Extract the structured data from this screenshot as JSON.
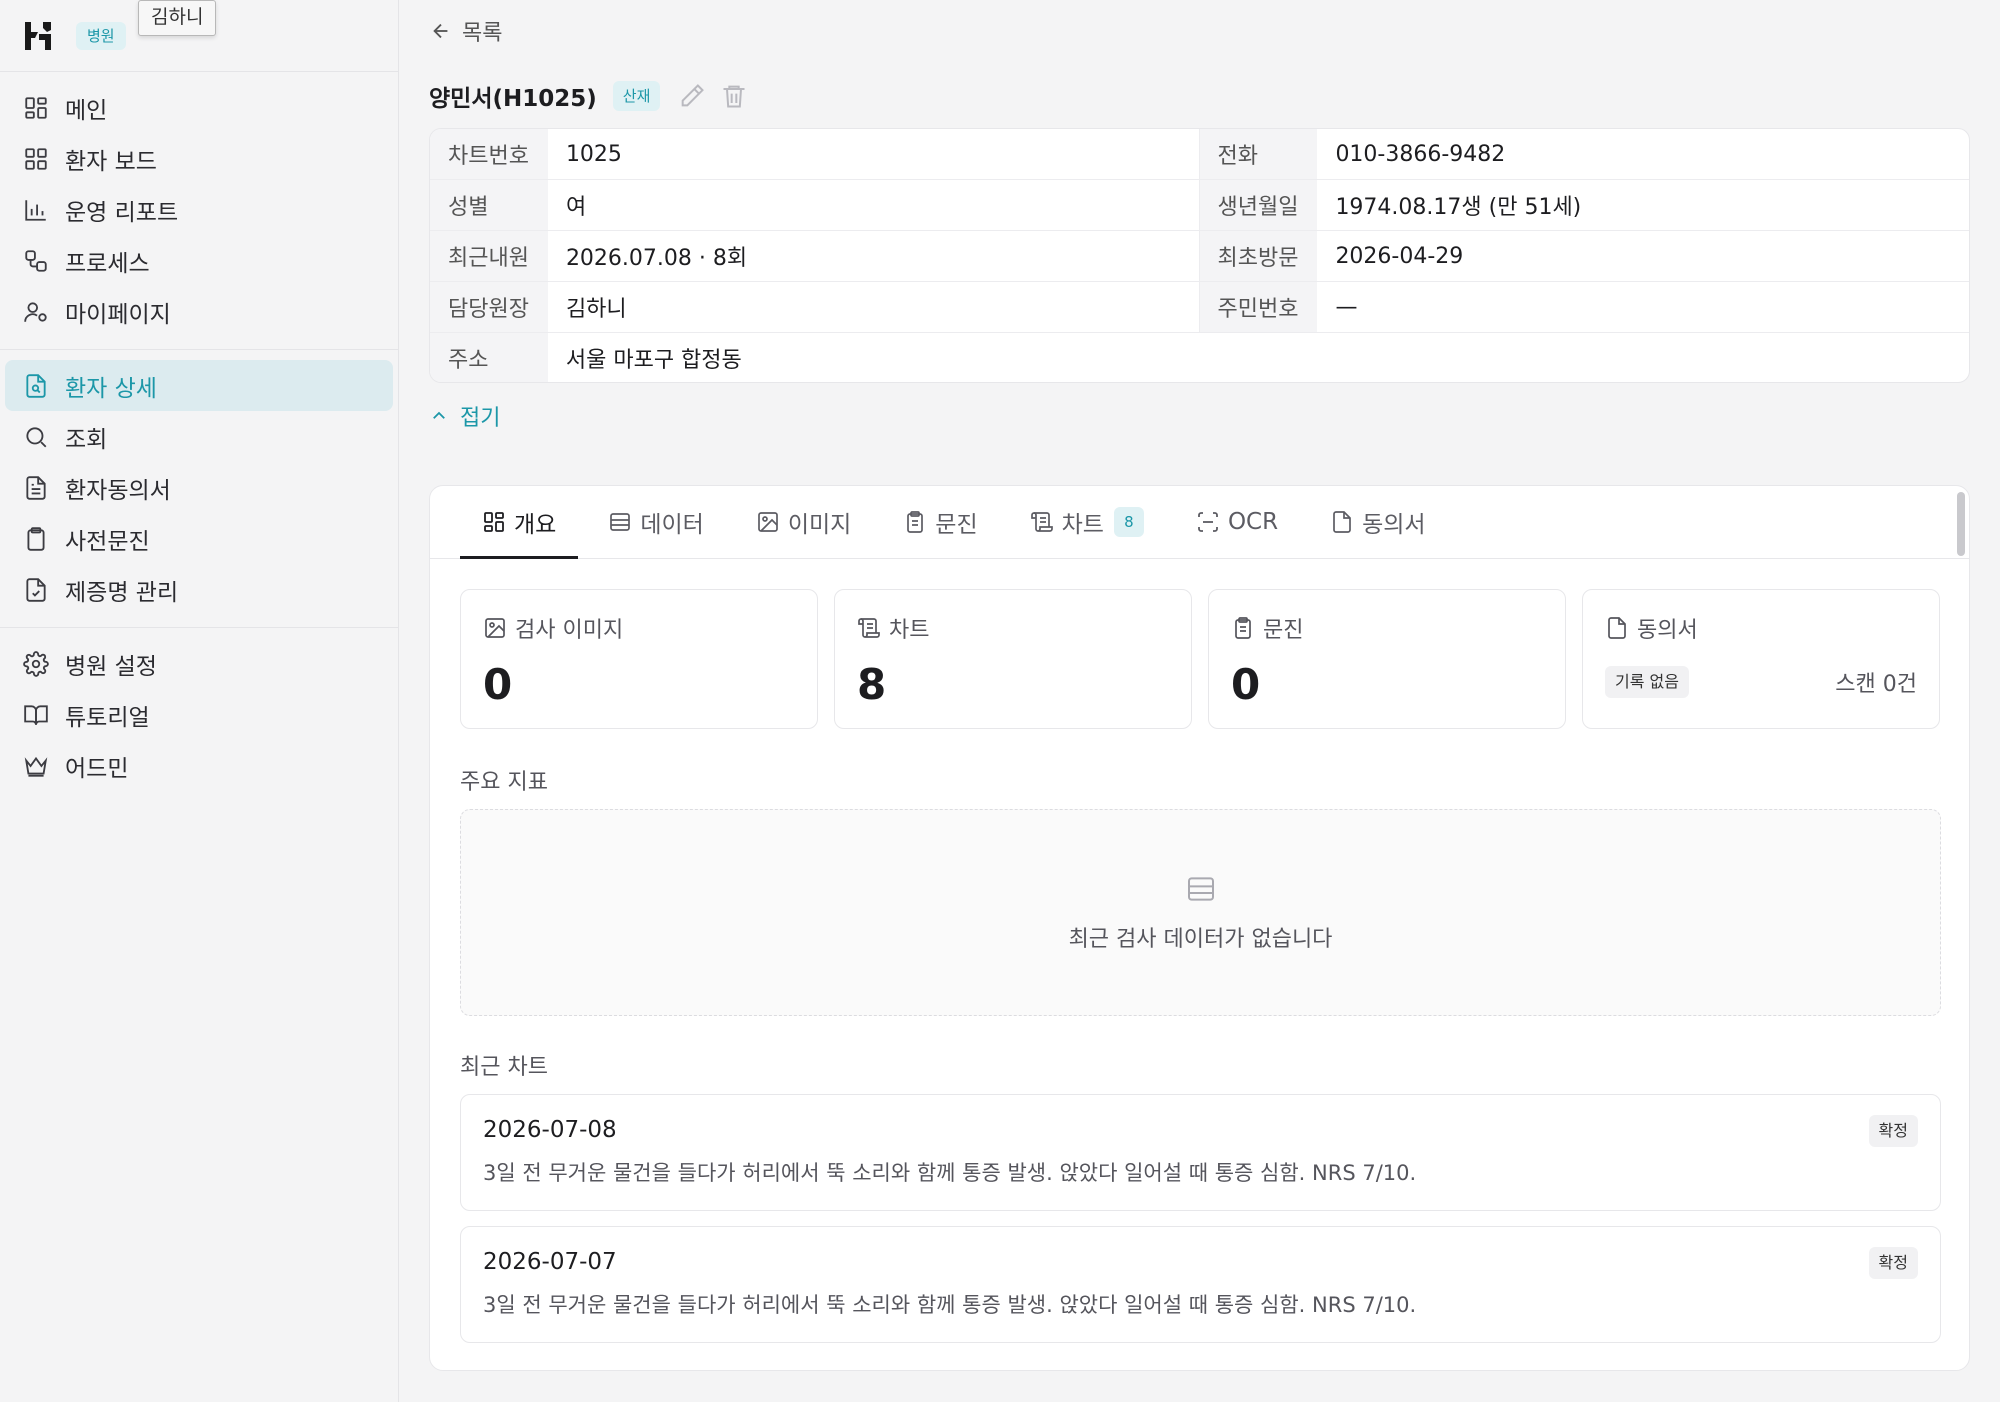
{
  "sidebar": {
    "hospital_badge": "병원",
    "user_tooltip": "김하니",
    "groups": [
      [
        {
          "label": "메인",
          "icon": "dashboard-icon"
        },
        {
          "label": "환자 보드",
          "icon": "grid-icon"
        },
        {
          "label": "운영 리포트",
          "icon": "bar-chart-icon"
        },
        {
          "label": "프로세스",
          "icon": "workflow-icon"
        },
        {
          "label": "마이페이지",
          "icon": "user-settings-icon"
        }
      ],
      [
        {
          "label": "환자 상세",
          "icon": "file-search-icon",
          "active": true
        },
        {
          "label": "조회",
          "icon": "search-icon"
        },
        {
          "label": "환자동의서",
          "icon": "document-icon"
        },
        {
          "label": "사전문진",
          "icon": "clipboard-icon"
        },
        {
          "label": "제증명 관리",
          "icon": "file-check-icon"
        }
      ],
      [
        {
          "label": "병원 설정",
          "icon": "gear-icon"
        },
        {
          "label": "튜토리얼",
          "icon": "book-icon"
        },
        {
          "label": "어드민",
          "icon": "crown-icon"
        }
      ]
    ]
  },
  "header": {
    "back_label": "목록",
    "patient_name": "양민서(H1025)",
    "tag": "산재"
  },
  "info": {
    "rows": [
      [
        {
          "label": "차트번호",
          "value": "1025"
        },
        {
          "label": "전화",
          "value": "010-3866-9482"
        }
      ],
      [
        {
          "label": "성별",
          "value": "여"
        },
        {
          "label": "생년월일",
          "value": "1974.08.17생 (만 51세)"
        }
      ],
      [
        {
          "label": "최근내원",
          "value": "2026.07.08 · 8회"
        },
        {
          "label": "최초방문",
          "value": "2026-04-29"
        }
      ],
      [
        {
          "label": "담당원장",
          "value": "김하니"
        },
        {
          "label": "주민번호",
          "value": "—"
        }
      ]
    ],
    "address_label": "주소",
    "address_value": "서울 마포구 합정동",
    "collapse_label": "접기"
  },
  "tabs": [
    {
      "label": "개요",
      "icon": "overview-icon",
      "active": true
    },
    {
      "label": "데이터",
      "icon": "table-icon"
    },
    {
      "label": "이미지",
      "icon": "image-icon"
    },
    {
      "label": "문진",
      "icon": "clipboard-icon"
    },
    {
      "label": "차트",
      "icon": "chart-scroll-icon",
      "count": "8"
    },
    {
      "label": "OCR",
      "icon": "scan-icon"
    },
    {
      "label": "동의서",
      "icon": "document-icon"
    }
  ],
  "stats": {
    "images": {
      "label": "검사 이미지",
      "value": "0"
    },
    "charts": {
      "label": "차트",
      "value": "8"
    },
    "questionnaires": {
      "label": "문진",
      "value": "0"
    },
    "consents": {
      "label": "동의서",
      "badge": "기록 없음",
      "scan": "스캔 0건"
    }
  },
  "key_metrics": {
    "title": "주요 지표",
    "empty_text": "최근 검사 데이터가 없습니다"
  },
  "recent_charts": {
    "title": "최근 차트",
    "items": [
      {
        "date": "2026-07-08",
        "text": "3일 전 무거운 물건을 들다가 허리에서 뚝 소리와 함께 통증 발생. 앉았다 일어설 때 통증 심함. NRS 7/10.",
        "status": "확정"
      },
      {
        "date": "2026-07-07",
        "text": "3일 전 무거운 물건을 들다가 허리에서 뚝 소리와 함께 통증 발생. 앉았다 일어설 때 통증 심함. NRS 7/10.",
        "status": "확정"
      }
    ]
  },
  "colors": {
    "accent": "#1c97a8",
    "accent_bg": "#dff1f4",
    "active_nav_bg": "#dcebef"
  }
}
